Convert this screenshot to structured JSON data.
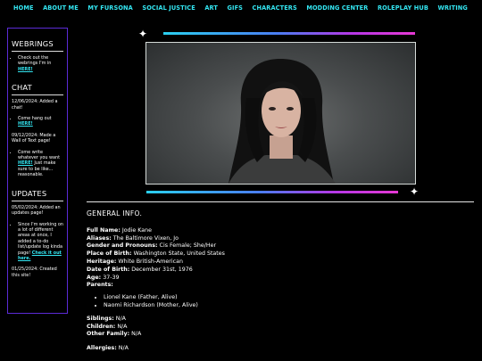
{
  "nav": [
    "HOME",
    "ABOUT ME",
    "MY FURSONA",
    "SOCIAL JUSTICE",
    "ART",
    "GIFS",
    "CHARACTERS",
    "MODDING CENTER",
    "ROLEPLAY HUB",
    "WRITING"
  ],
  "sidebar": {
    "webrings": {
      "title": "WEBRINGS",
      "item_text": "Check out the webrings I'm in",
      "item_link": "HERE!"
    },
    "chat": {
      "title": "CHAT",
      "entry1_date": "12/06/2024: Added a chat!",
      "entry1_item_text": "Come hang out",
      "entry1_item_link": "HERE!",
      "entry2_date": "09/12/2024: Made a Wall of Text page!",
      "entry2_item_text": "Come write whatever you want",
      "entry2_item_link": "HERE!",
      "entry2_item_tail": "Just make sure to be like... reasonable."
    },
    "updates": {
      "title": "UPDATES",
      "entry1_date": "05/02/2024: Added an updates page!",
      "entry1_item_text": "Since I'm working on a lot of different areas at once, I added a to-do list/update log kinda page!",
      "entry1_item_link": "Check it out here.",
      "entry2_date": "01/25/2024: Created this site!"
    }
  },
  "section_title": "GENERAL INFO.",
  "fields": {
    "full_name_label": "Full Name:",
    "full_name": "Jodie Kane",
    "aliases_label": "Aliases:",
    "aliases": "The Baltimore Vixen, Jo",
    "gender_label": "Gender and Pronouns:",
    "gender": "Cis Female; She/Her",
    "birthplace_label": "Place of Birth:",
    "birthplace": "Washington State, United States",
    "heritage_label": "Heritage:",
    "heritage": "White British-American",
    "dob_label": "Date of Birth:",
    "dob": "December 31st, 1976",
    "age_label": "Age:",
    "age": "37-39",
    "parents_label": "Parents:",
    "parents": [
      "Lionel Kane (Father, Alive)",
      "Naomi Richardson (Mother, Alive)"
    ],
    "siblings_label": "Siblings:",
    "siblings": "N/A",
    "children_label": "Children:",
    "children": "N/A",
    "other_family_label": "Other Family:",
    "other_family": "N/A",
    "allergies_label": "Allergies:",
    "allergies": "N/A"
  }
}
